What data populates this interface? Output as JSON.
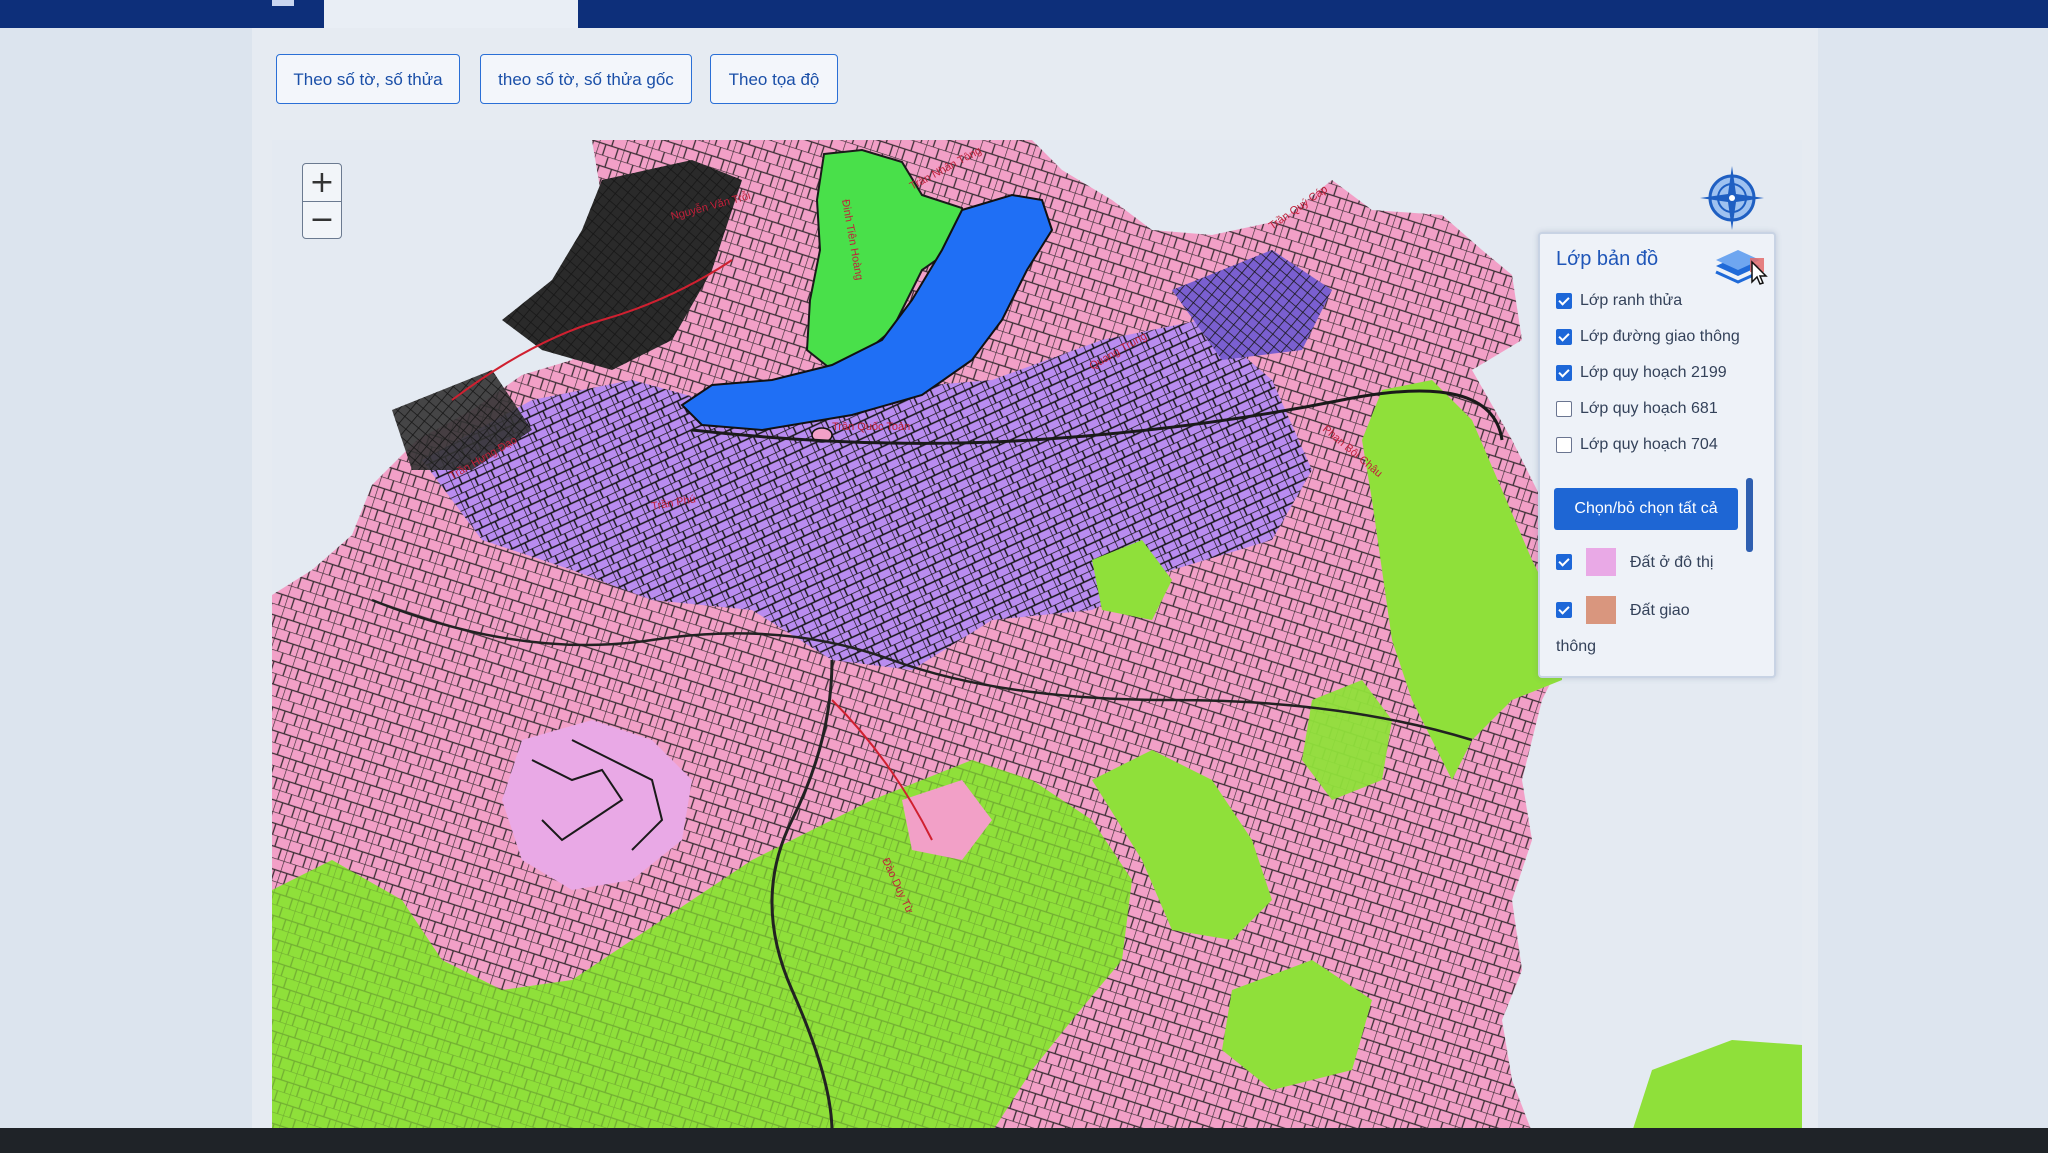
{
  "search_tabs": [
    {
      "label": "Theo số tờ, số thửa"
    },
    {
      "label": "theo số tờ, số thửa gốc"
    },
    {
      "label": "Theo tọa độ"
    }
  ],
  "map": {
    "zoom_in": "+",
    "zoom_out": "−",
    "street_labels": [
      "Trần Nhân Tông",
      "Đinh Tiên Hoàng",
      "Trần Quý Cáp",
      "Quang Trung",
      "Trần Quốc Toản",
      "Đào Duy Từ",
      "Nguyễn Văn Trỗi",
      "Trần Hưng Đạo",
      "Trần Phú",
      "Phan Bội Châu"
    ]
  },
  "layer_panel": {
    "title": "Lớp bản đồ",
    "layers": [
      {
        "label": "Lớp ranh thửa",
        "checked": true
      },
      {
        "label": "Lớp đường giao thông",
        "checked": true
      },
      {
        "label": "Lớp quy hoạch 2199",
        "checked": true
      },
      {
        "label": "Lớp quy hoạch 681",
        "checked": false
      },
      {
        "label": "Lớp quy hoạch 704",
        "checked": false
      }
    ],
    "select_all_label": "Chọn/bỏ chọn tất cả",
    "legend": [
      {
        "label": "Đất ở đô thị",
        "color": "#e9a9e6",
        "checked": true
      },
      {
        "label": "Đất giao",
        "label_cont": "thông",
        "color": "#d9967e",
        "checked": true
      }
    ]
  },
  "colors": {
    "urban_land": "#f2a0c7",
    "green_land": "#8fe03a",
    "water": "#1f6ff5",
    "residential": "#b98cf0",
    "accent": "#1e66d4"
  }
}
